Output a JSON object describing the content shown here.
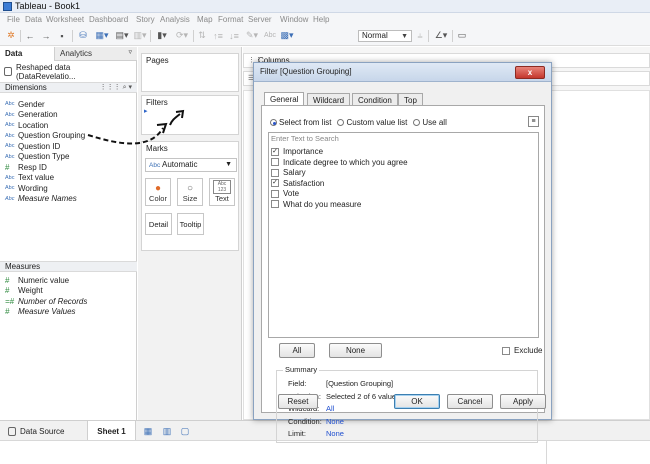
{
  "window": {
    "title": "Tableau - Book1"
  },
  "menu": [
    "File",
    "Data",
    "Worksheet",
    "Dashboard",
    "Story",
    "Analysis",
    "Map",
    "Format",
    "Server",
    "Window",
    "Help"
  ],
  "toolbar": {
    "view_size": "Normal",
    "abc_label": "Abc"
  },
  "left_pane": {
    "tabs": [
      "Data",
      "Analytics"
    ],
    "data_source": "Reshaped data (DataRevelatio...",
    "dimensions_label": "Dimensions",
    "dimensions": [
      {
        "type": "Abc",
        "name": "Gender"
      },
      {
        "type": "Abc",
        "name": "Generation"
      },
      {
        "type": "Abc",
        "name": "Location"
      },
      {
        "type": "Abc",
        "name": "Question Grouping"
      },
      {
        "type": "Abc",
        "name": "Question ID"
      },
      {
        "type": "Abc",
        "name": "Question Type"
      },
      {
        "type": "#",
        "name": "Resp ID"
      },
      {
        "type": "Abc",
        "name": "Text value"
      },
      {
        "type": "Abc",
        "name": "Wording"
      },
      {
        "type": "Abc",
        "name": "Measure Names"
      }
    ],
    "measures_label": "Measures",
    "measures": [
      {
        "type": "#",
        "name": "Numeric value"
      },
      {
        "type": "#",
        "name": "Weight"
      },
      {
        "type": "=#",
        "name": "Number of Records"
      },
      {
        "type": "#",
        "name": "Measure Values"
      }
    ]
  },
  "cards": {
    "pages": "Pages",
    "filters": "Filters",
    "marks": "Marks",
    "mark_type": "Automatic",
    "mark_type_prefix": "Abc",
    "buttons": [
      "Color",
      "Size",
      "Text",
      "Detail",
      "Tooltip"
    ],
    "text_glyph": "Abc 123"
  },
  "shelves": {
    "columns": "Columns"
  },
  "dialog": {
    "title": "Filter [Question Grouping]",
    "close": "x",
    "tabs": [
      "General",
      "Wildcard",
      "Condition",
      "Top"
    ],
    "select_mode": [
      "Select from list",
      "Custom value list",
      "Use all"
    ],
    "search_placeholder": "Enter Text to Search",
    "items": [
      {
        "label": "Importance",
        "checked": true
      },
      {
        "label": "Indicate degree to which you agree",
        "checked": false
      },
      {
        "label": "Salary",
        "checked": false
      },
      {
        "label": "Satisfaction",
        "checked": true
      },
      {
        "label": "Vote",
        "checked": false
      },
      {
        "label": "What do you measure",
        "checked": false
      }
    ],
    "all_button": "All",
    "none_button": "None",
    "exclude": "Exclude",
    "summary": {
      "heading": "Summary",
      "rows": [
        {
          "k": "Field:",
          "v": "[Question Grouping]",
          "blue": false
        },
        {
          "k": "Selection:",
          "v": "Selected 2 of 6 values",
          "blue": false
        },
        {
          "k": "Wildcard:",
          "v": "All",
          "blue": true
        },
        {
          "k": "Condition:",
          "v": "None",
          "blue": true
        },
        {
          "k": "Limit:",
          "v": "None",
          "blue": true
        }
      ]
    },
    "reset": "Reset",
    "ok": "OK",
    "cancel": "Cancel",
    "apply": "Apply"
  },
  "bottom": {
    "data_source": "Data Source",
    "sheet": "Sheet 1"
  }
}
